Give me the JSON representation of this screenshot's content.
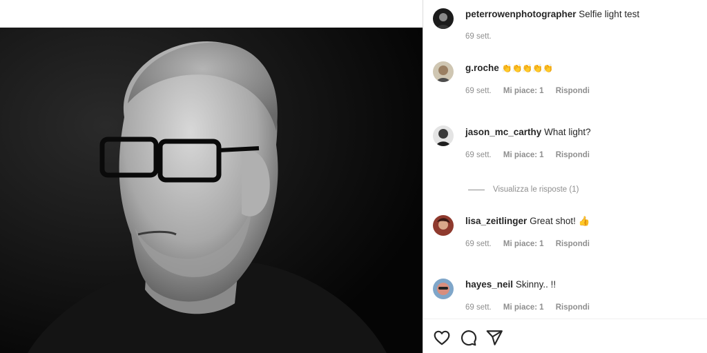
{
  "post": {
    "username": "peterrowenphotographer",
    "caption": "Selfie light test",
    "time": "69 sett."
  },
  "labels": {
    "likes_prefix": "Mi piace:",
    "reply": "Rispondi",
    "view_replies": "Visualizza le risposte (1)"
  },
  "comments": [
    {
      "username": "g.roche",
      "text": "👏👏👏👏👏",
      "time": "69 sett.",
      "likes": "1"
    },
    {
      "username": "jason_mc_carthy",
      "text": "What light?",
      "time": "69 sett.",
      "likes": "1"
    },
    {
      "username": "lisa_zeitlinger",
      "text": "Great shot! 👍",
      "time": "69 sett.",
      "likes": "1"
    },
    {
      "username": "hayes_neil",
      "text": "Skinny.. !!",
      "time": "69 sett.",
      "likes": "1"
    }
  ],
  "icons": [
    "heart-icon",
    "comment-icon",
    "share-icon"
  ]
}
